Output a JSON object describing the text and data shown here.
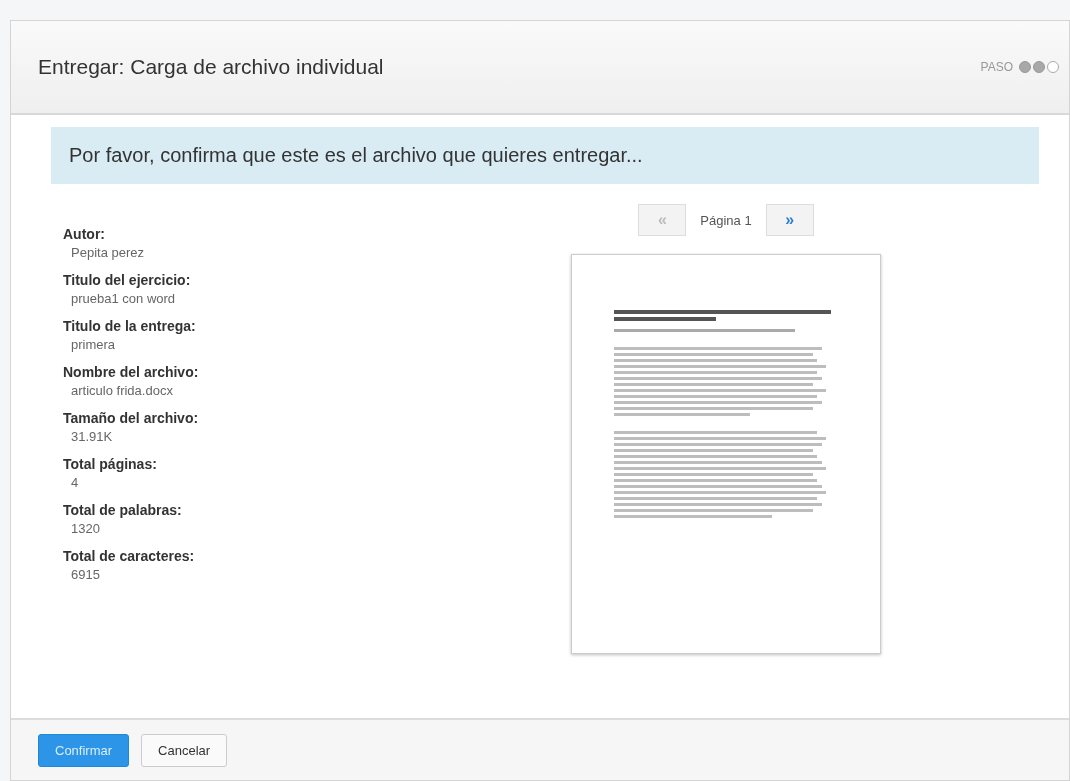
{
  "header": {
    "title": "Entregar: Carga de archivo individual",
    "step_label": "PASO",
    "steps": [
      {
        "done": true
      },
      {
        "done": true
      },
      {
        "done": false
      }
    ]
  },
  "banner": "Por favor, confirma que este es el archivo que quieres entregar...",
  "details": [
    {
      "label": "Autor:",
      "value": "Pepita perez"
    },
    {
      "label": "Titulo del ejercicio:",
      "value": "prueba1 con word"
    },
    {
      "label": "Titulo de la entrega:",
      "value": "primera"
    },
    {
      "label": "Nombre del archivo:",
      "value": "articulo frida.docx"
    },
    {
      "label": "Tamaño del archivo:",
      "value": "31.91K"
    },
    {
      "label": "Total páginas:",
      "value": "4"
    },
    {
      "label": "Total de palabras:",
      "value": "1320"
    },
    {
      "label": "Total de caracteres:",
      "value": "6915"
    }
  ],
  "pager": {
    "prev": "«",
    "page": "Página 1",
    "next": "»",
    "prev_disabled": true,
    "next_disabled": false
  },
  "buttons": [
    {
      "label": "Confirmar",
      "kind": "primary"
    },
    {
      "label": "Cancelar",
      "kind": "default"
    }
  ]
}
